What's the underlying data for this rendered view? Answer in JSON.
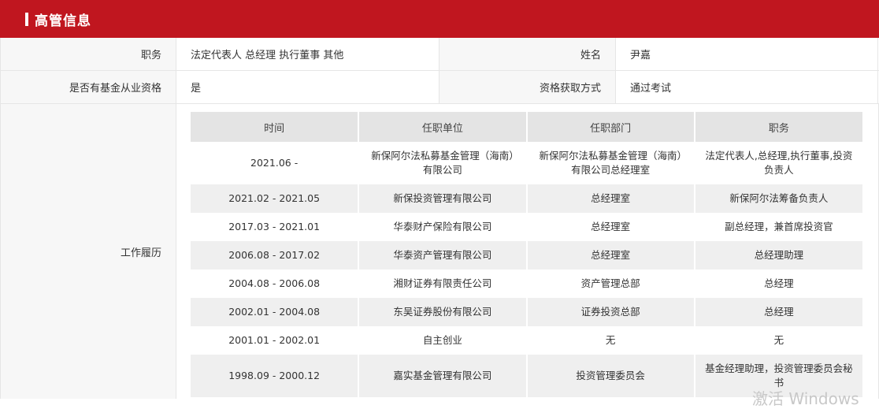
{
  "header": {
    "title": "高管信息"
  },
  "info": {
    "position_label": "职务",
    "position_value": "法定代表人 总经理 执行董事 其他",
    "name_label": "姓名",
    "name_value": "尹嘉",
    "fund_qual_label": "是否有基金从业资格",
    "fund_qual_value": "是",
    "qual_method_label": "资格获取方式",
    "qual_method_value": "通过考试"
  },
  "work": {
    "label": "工作履历",
    "columns": [
      "时间",
      "任职单位",
      "任职部门",
      "职务"
    ],
    "rows": [
      [
        "2021.06 -",
        "新保阿尔法私募基金管理（海南）有限公司",
        "新保阿尔法私募基金管理（海南）有限公司总经理室",
        "法定代表人,总经理,执行董事,投资负责人"
      ],
      [
        "2021.02 - 2021.05",
        "新保投资管理有限公司",
        "总经理室",
        "新保阿尔法筹备负责人"
      ],
      [
        "2017.03 - 2021.01",
        "华泰财产保险有限公司",
        "总经理室",
        "副总经理，兼首席投资官"
      ],
      [
        "2006.08 - 2017.02",
        "华泰资产管理有限公司",
        "总经理室",
        "总经理助理"
      ],
      [
        "2004.08 - 2006.08",
        "湘财证券有限责任公司",
        "资产管理总部",
        "总经理"
      ],
      [
        "2002.01 - 2004.08",
        "东吴证券股份有限公司",
        "证券投资总部",
        "总经理"
      ],
      [
        "2001.01 - 2002.01",
        "自主创业",
        "无",
        "无"
      ],
      [
        "1998.09 - 2000.12",
        "嘉实基金管理有限公司",
        "投资管理委员会",
        "基金经理助理，投资管理委员会秘书"
      ]
    ]
  },
  "watermark": "激活 Windows"
}
